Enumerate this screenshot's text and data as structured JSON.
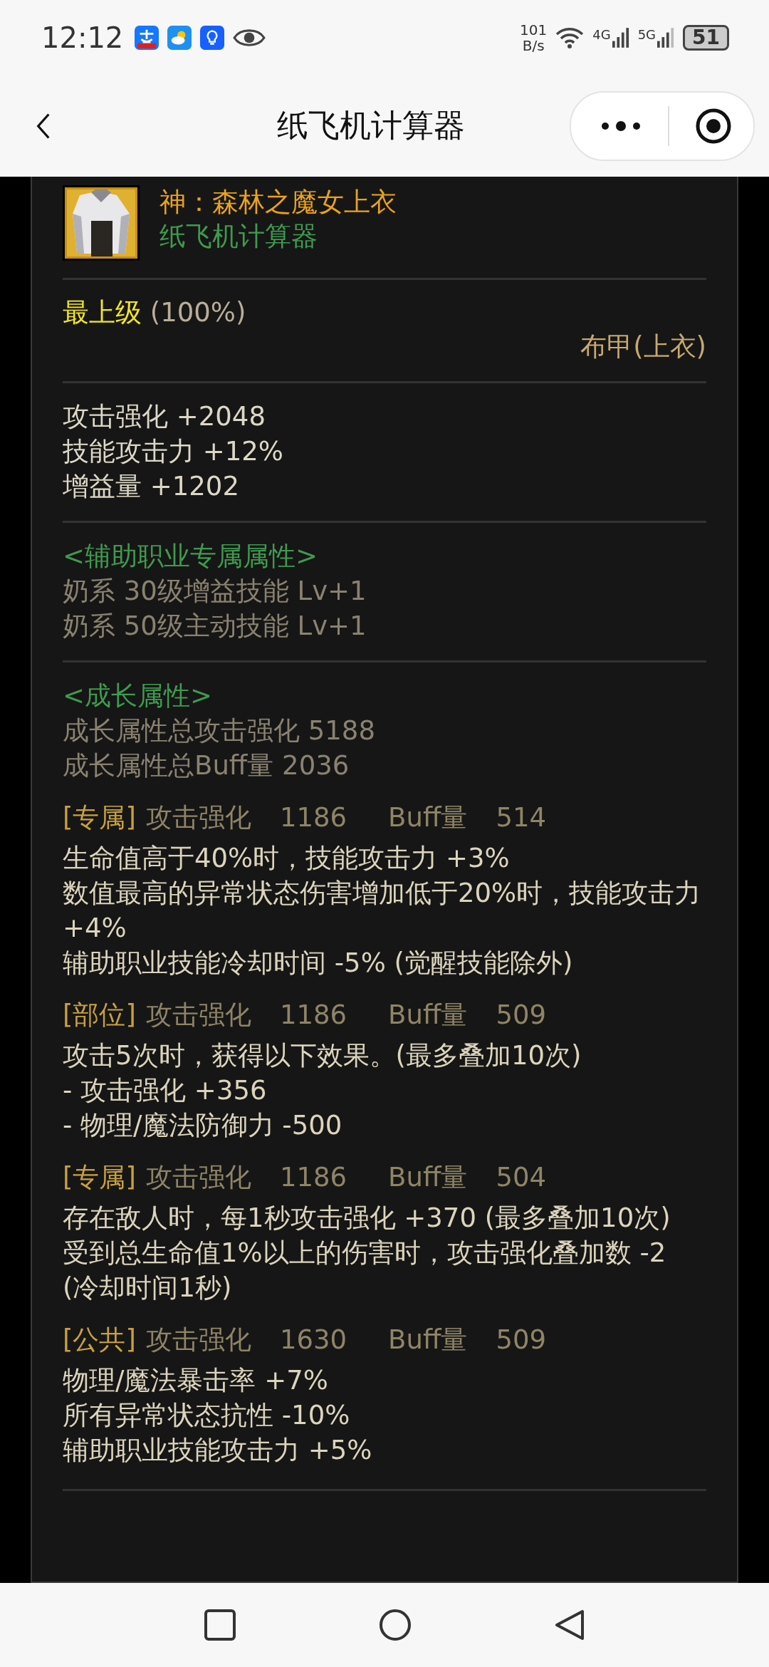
{
  "status_bar": {
    "time": "12:12",
    "speed_value": "101",
    "speed_unit": "B/s",
    "signal_1": "4G",
    "signal_2": "5G",
    "battery": "51"
  },
  "header": {
    "title": "纸飞机计算器"
  },
  "item": {
    "name": "神：森林之魔女上衣",
    "source": "纸飞机计算器",
    "grade": "最上级",
    "grade_percent": "(100%)",
    "type": "布甲(上衣)"
  },
  "stats": [
    "攻击强化 +2048",
    "技能攻击力 +12%",
    "增益量 +1202"
  ],
  "support": {
    "header": "<辅助职业专属属性>",
    "lines": [
      "奶系 30级增益技能 Lv+1",
      "奶系 50级主动技能 Lv+1"
    ]
  },
  "growth": {
    "header": "<成长属性>",
    "lines": [
      "成长属性总攻击强化 5188",
      "成长属性总Buff量 2036"
    ],
    "options": [
      {
        "tag": "[专属]",
        "stat_1_label": "攻击强化",
        "stat_1_value": "1186",
        "stat_2_label": "Buff量",
        "stat_2_value": "514",
        "lines": [
          "生命值高于40%时，技能攻击力 +3%",
          "数值最高的异常状态伤害增加低于20%时，技能攻击力 +4%",
          "辅助职业技能冷却时间 -5% (觉醒技能除外)"
        ]
      },
      {
        "tag": "[部位]",
        "stat_1_label": "攻击强化",
        "stat_1_value": "1186",
        "stat_2_label": "Buff量",
        "stat_2_value": "509",
        "lines": [
          "攻击5次时，获得以下效果。(最多叠加10次)",
          "- 攻击强化 +356",
          "- 物理/魔法防御力 -500"
        ]
      },
      {
        "tag": "[专属]",
        "stat_1_label": "攻击强化",
        "stat_1_value": "1186",
        "stat_2_label": "Buff量",
        "stat_2_value": "504",
        "lines": [
          "存在敌人时，每1秒攻击强化 +370 (最多叠加10次)",
          "受到总生命值1%以上的伤害时，攻击强化叠加数 -2 (冷却时间1秒)"
        ]
      },
      {
        "tag": "[公共]",
        "stat_1_label": "攻击强化",
        "stat_1_value": "1630",
        "stat_2_label": "Buff量",
        "stat_2_value": "509",
        "lines": [
          "物理/魔法暴击率 +7%",
          "所有异常状态抗性 -10%",
          "辅助职业技能攻击力 +5%"
        ]
      }
    ]
  }
}
